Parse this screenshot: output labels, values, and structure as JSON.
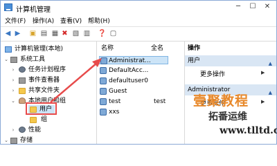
{
  "window": {
    "title": "计算机管理"
  },
  "menu": [
    "文件(F)",
    "操作(A)",
    "查看(V)",
    "帮助(H)"
  ],
  "toolbar": [
    "back-icon",
    "forward-icon",
    "folder-up-icon",
    "view-icon",
    "delete-icon",
    "properties-icon",
    "refresh-icon",
    "export-icon",
    "help-icon",
    "panel-icon"
  ],
  "tree": {
    "root": "计算机管理(本地)",
    "system_tools": "系统工具",
    "task_scheduler": "任务计划程序",
    "event_viewer": "事件查看器",
    "shared_folders": "共享文件夹",
    "local_users_groups": "本地用户和组",
    "users": "用户",
    "groups": "组",
    "performance": "性能",
    "storage": "存储"
  },
  "list": {
    "col_name": "名称",
    "col_fullname": "全名",
    "rows": [
      {
        "name": "Administrat...",
        "fullname": ""
      },
      {
        "name": "DefaultAcc...",
        "fullname": ""
      },
      {
        "name": "defaultuser0",
        "fullname": ""
      },
      {
        "name": "Guest",
        "fullname": ""
      },
      {
        "name": "test",
        "fullname": "test"
      },
      {
        "name": "xxs",
        "fullname": ""
      }
    ]
  },
  "actions": {
    "header": "操作",
    "section1": "用户",
    "more1": "更多操作",
    "section2": "Administrator",
    "more2": "更多操作"
  },
  "watermark": {
    "line1": "壹聚教程",
    "line2": "拓番运维",
    "line3": "www.tlltd.cn"
  },
  "colors": {
    "accent": "#3b78c3",
    "highlight": "#e74b4b",
    "watermark": "#e8892b"
  }
}
